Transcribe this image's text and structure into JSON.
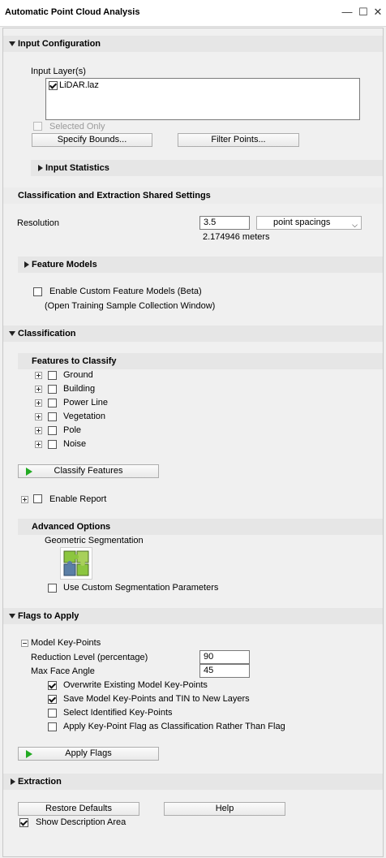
{
  "window": {
    "title": "Automatic Point Cloud Analysis",
    "controls": [
      "—",
      "☐",
      "✕"
    ]
  },
  "input_configuration": {
    "header": "Input Configuration",
    "input_layers_label": "Input Layer(s)",
    "layers": [
      {
        "name": "LiDAR.laz",
        "checked": true
      }
    ],
    "selected_only_label": "Selected Only",
    "specify_bounds_label": "Specify Bounds...",
    "filter_points_label": "Filter Points...",
    "input_statistics_label": "Input Statistics"
  },
  "shared_settings": {
    "header": "Classification and Extraction Shared Settings",
    "resolution_label": "Resolution",
    "resolution_value": "3.5",
    "resolution_unit": "point spacings",
    "resolution_meters": "2.174946 meters",
    "feature_models_label": "Feature Models",
    "custom_models_label": "Enable Custom Feature Models (Beta)",
    "training_window_label": "(Open Training Sample Collection Window)"
  },
  "classification": {
    "header": "Classification",
    "features_header": "Features to Classify",
    "features": [
      "Ground",
      "Building",
      "Power Line",
      "Vegetation",
      "Pole",
      "Noise"
    ],
    "classify_button": "Classify Features",
    "enable_report_label": "Enable Report",
    "advanced_header": "Advanced Options",
    "geometric_segmentation_label": "Geometric Segmentation",
    "custom_segmentation_label": "Use Custom Segmentation Parameters"
  },
  "flags": {
    "header": "Flags to Apply",
    "model_keypoints_label": "Model Key-Points",
    "reduction_label": "Reduction Level (percentage)",
    "reduction_value": "90",
    "max_face_label": "Max Face Angle",
    "max_face_value": "45",
    "options": [
      {
        "label": "Overwrite Existing Model Key-Points",
        "checked": true
      },
      {
        "label": "Save Model Key-Points and TIN to New Layers",
        "checked": true
      },
      {
        "label": "Select Identified Key-Points",
        "checked": false
      },
      {
        "label": "Apply Key-Point Flag as Classification Rather Than Flag",
        "checked": false
      }
    ],
    "apply_button": "Apply Flags"
  },
  "extraction": {
    "header": "Extraction"
  },
  "footer": {
    "restore_label": "Restore Defaults",
    "help_label": "Help",
    "show_description_label": "Show Description Area"
  },
  "colors": {
    "play_icon": "#22aa22",
    "puzzle_green": "#8cc63f",
    "puzzle_blue": "#5b7fa6"
  }
}
